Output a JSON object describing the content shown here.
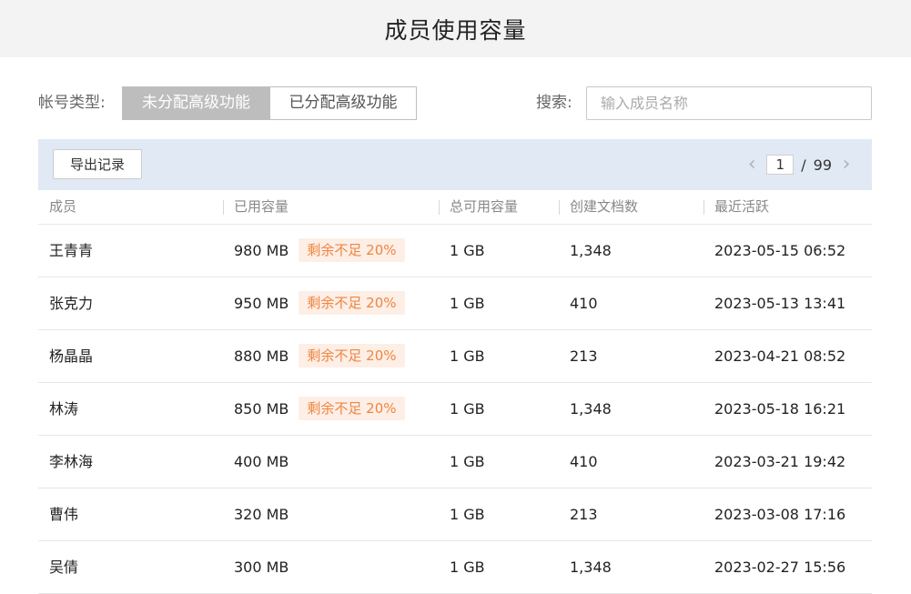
{
  "page": {
    "title": "成员使用容量"
  },
  "filter": {
    "account_type_label": "帐号类型:",
    "options": [
      "未分配高级功能",
      "已分配高级功能"
    ],
    "active_option": "未分配高级功能",
    "search_label": "搜索:",
    "search_placeholder": "输入成员名称",
    "search_value": ""
  },
  "toolbar": {
    "export_label": "导出记录",
    "pager": {
      "current_page": "1",
      "separator": "/",
      "total_pages": "99"
    }
  },
  "colors": {
    "active_segment": "#bdbdbd",
    "toolbar_bg": "#e1e9f4",
    "warning_tag_bg": "#fdeee6",
    "warning_tag_text": "#f0853f"
  },
  "icons": {
    "prev": "chevron-left-icon",
    "next": "chevron-right-icon"
  },
  "table": {
    "headers": [
      "成员",
      "已用容量",
      "总可用容量",
      "创建文档数",
      "最近活跃"
    ],
    "rows": [
      {
        "name": "王青青",
        "used": "980 MB",
        "tag": "剩余不足 20%",
        "total": "1 GB",
        "docs": "1,348",
        "last_active": "2023-05-15 06:52"
      },
      {
        "name": "张克力",
        "used": "950 MB",
        "tag": "剩余不足 20%",
        "total": "1 GB",
        "docs": "410",
        "last_active": "2023-05-13 13:41"
      },
      {
        "name": "杨晶晶",
        "used": "880 MB",
        "tag": "剩余不足 20%",
        "total": "1 GB",
        "docs": "213",
        "last_active": "2023-04-21 08:52"
      },
      {
        "name": "林涛",
        "used": "850 MB",
        "tag": "剩余不足 20%",
        "total": "1 GB",
        "docs": "1,348",
        "last_active": "2023-05-18 16:21"
      },
      {
        "name": "李林海",
        "used": "400 MB",
        "tag": "",
        "total": "1 GB",
        "docs": "410",
        "last_active": "2023-03-21 19:42"
      },
      {
        "name": "曹伟",
        "used": "320 MB",
        "tag": "",
        "total": "1 GB",
        "docs": "213",
        "last_active": "2023-03-08 17:16"
      },
      {
        "name": "吴倩",
        "used": "300 MB",
        "tag": "",
        "total": "1 GB",
        "docs": "1,348",
        "last_active": "2023-02-27 15:56"
      }
    ]
  }
}
